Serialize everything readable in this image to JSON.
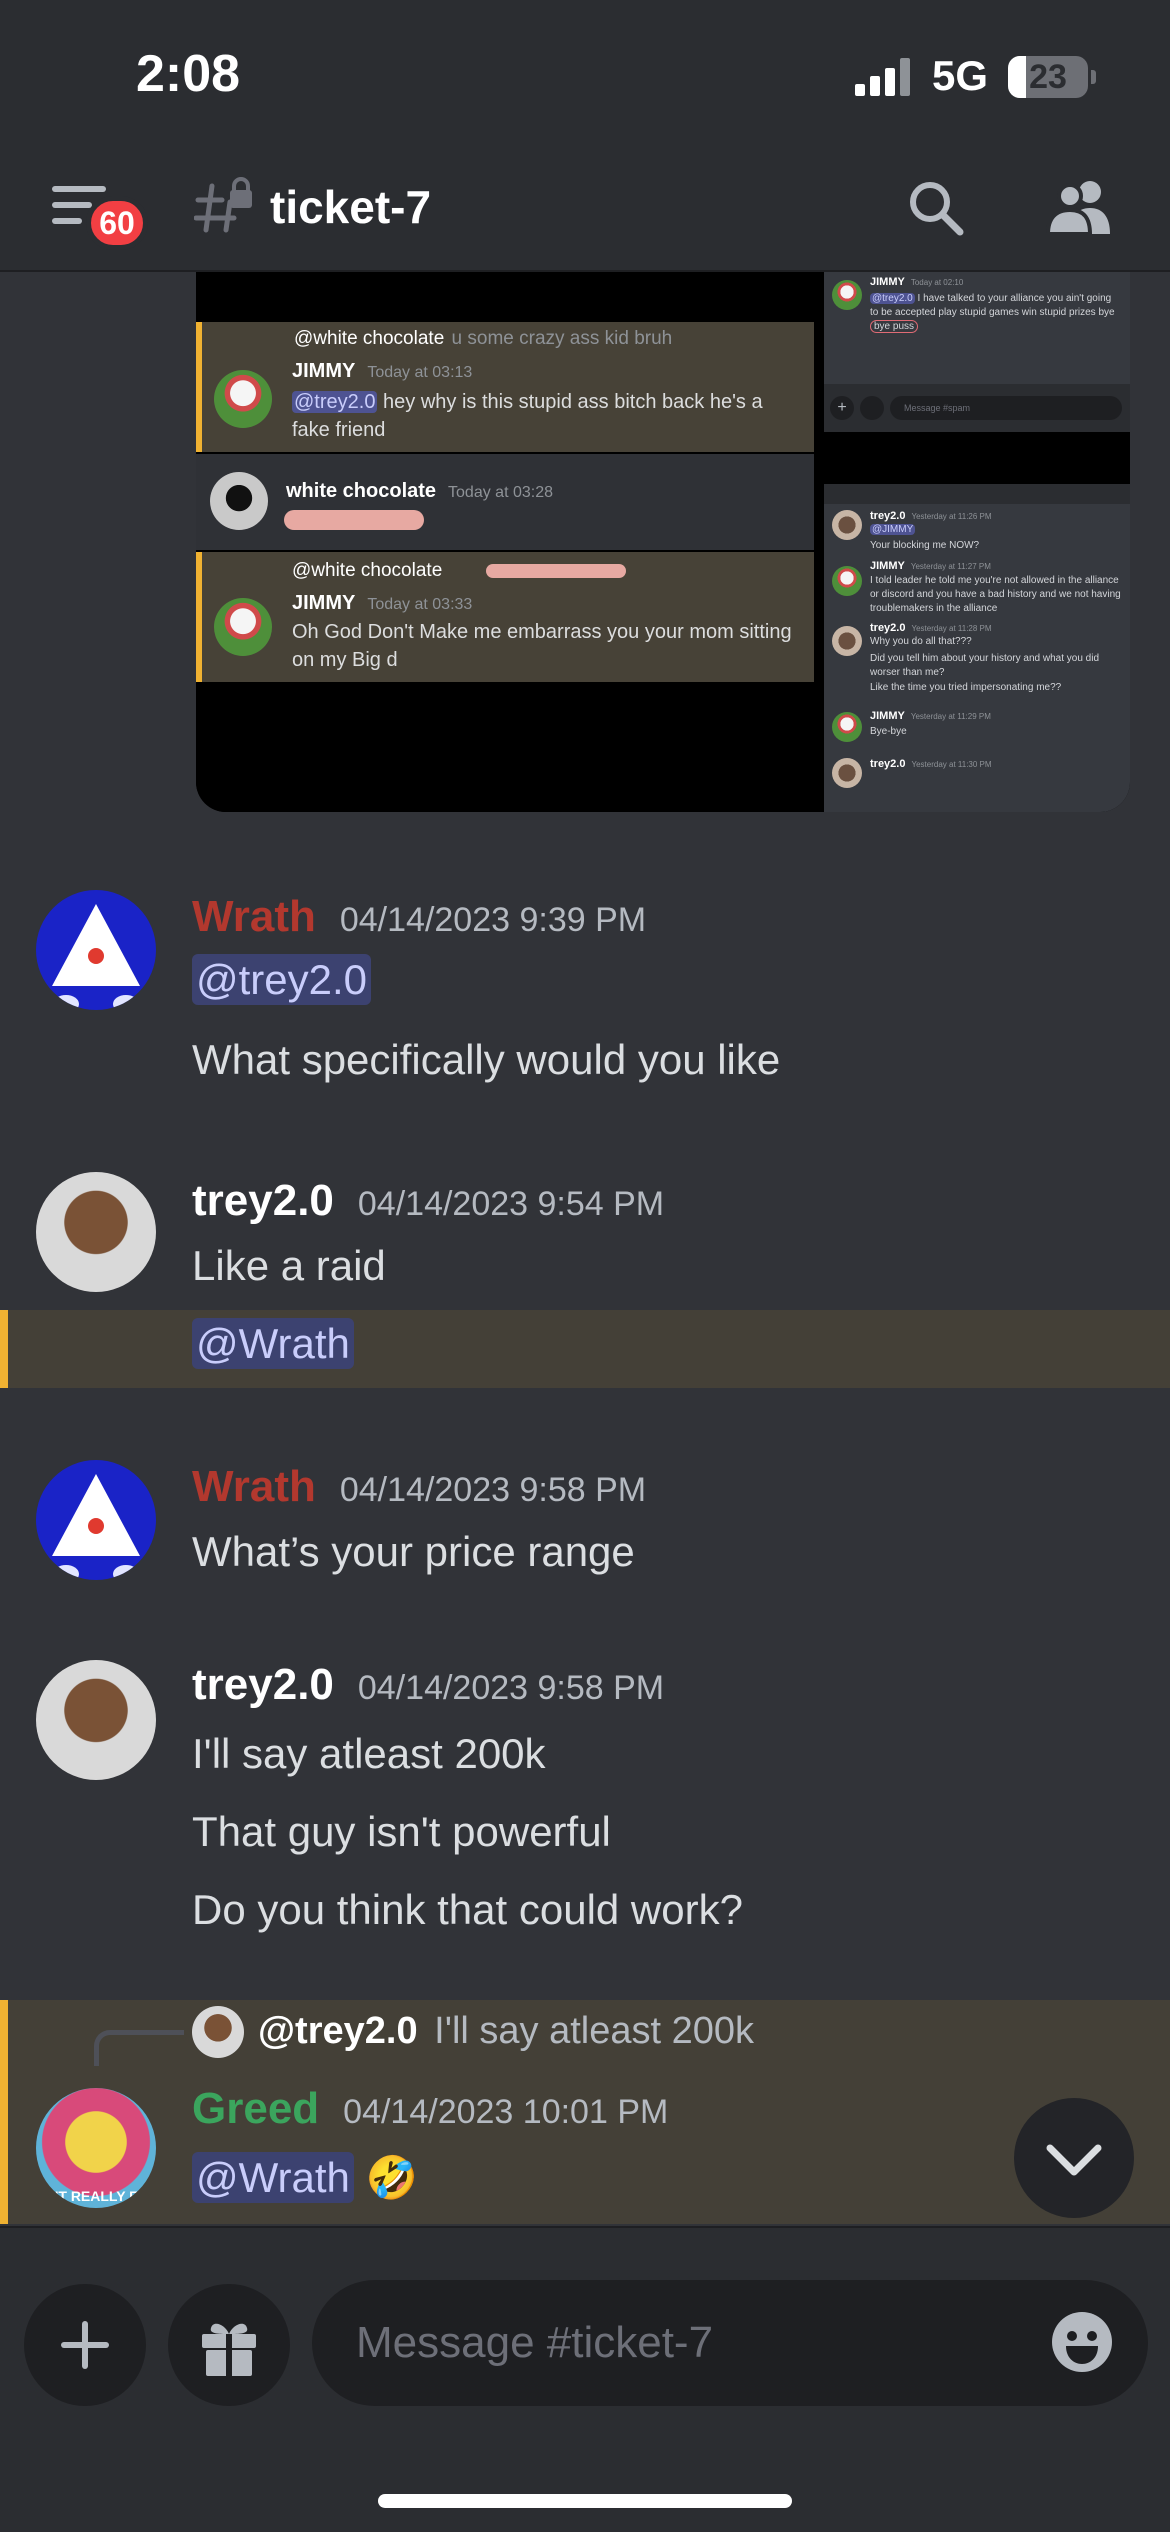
{
  "status_bar": {
    "time": "2:08",
    "network": "5G",
    "battery": "23"
  },
  "header": {
    "unread_badge": "60",
    "channel_name": "ticket-7"
  },
  "attachment": {
    "left_panel": {
      "reply1": {
        "mention": "@white chocolate",
        "text": "u some crazy ass kid bruh"
      },
      "msg1": {
        "author": "JIMMY",
        "time": "Today at 03:13",
        "mention": "@trey2.0",
        "text": "hey why is this stupid ass bitch back he's a fake friend"
      },
      "msg2": {
        "author": "white chocolate",
        "time": "Today at 03:28"
      },
      "reply2": {
        "mention": "@white chocolate"
      },
      "msg3": {
        "author": "JIMMY",
        "time": "Today at 03:33",
        "text": "Oh God Don't Make me embarrass you your mom sitting on my Big d"
      }
    },
    "right_panel": {
      "top_msg": {
        "author": "JIMMY",
        "time": "Today at 02:10",
        "mention": "@trey2.0",
        "text": "I have talked to your alliance you ain't going to be accepted play stupid games win stupid prizes bye",
        "circled": "bye puss"
      },
      "input_placeholder": "Message #spam",
      "messages": [
        {
          "author": "trey2.0",
          "time": "Yesterday at 11:26 PM",
          "mention": "@JIMMY",
          "text": "Your blocking me NOW?"
        },
        {
          "author": "JIMMY",
          "time": "Yesterday at 11:27 PM",
          "text": "I told leader he told me you're not allowed in the alliance or discord and you have a bad history and we not having troublemakers in the alliance"
        },
        {
          "author": "trey2.0",
          "time": "Yesterday at 11:28 PM",
          "text": "Why you do all that???",
          "text2": "Did you tell him about your history and what you did worser than me?",
          "text3": "Like the time you tried impersonating me??"
        },
        {
          "author": "JIMMY",
          "time": "Yesterday at 11:29 PM",
          "text": "Bye-bye"
        },
        {
          "author": "trey2.0",
          "time": "Yesterday at 11:30 PM"
        }
      ]
    }
  },
  "messages": [
    {
      "author": "Wrath",
      "author_color": "#b3382e",
      "timestamp": "04/14/2023 9:39 PM",
      "mention": "@trey2.0",
      "text": "What specifically would you like"
    },
    {
      "author": "trey2.0",
      "author_color": "#ffffff",
      "timestamp": "04/14/2023 9:54 PM",
      "text": "Like a raid",
      "mention": "@Wrath"
    },
    {
      "author": "Wrath",
      "author_color": "#b3382e",
      "timestamp": "04/14/2023 9:58 PM",
      "text": "What’s your price range"
    },
    {
      "author": "trey2.0",
      "author_color": "#ffffff",
      "timestamp": "04/14/2023 9:58 PM",
      "lines": [
        "I'll say atleast 200k",
        "That guy isn't powerful",
        "Do you think that could work?"
      ]
    },
    {
      "author": "Greed",
      "author_color": "#3ba55d",
      "timestamp": "04/14/2023 10:01 PM",
      "reply_to": "@trey2.0",
      "reply_text": "I'll say atleast 200k",
      "mention": "@Wrath",
      "emoji": "🤣",
      "avatar_caption": "N'T REALLY FE"
    }
  ],
  "composer": {
    "placeholder": "Message #ticket-7"
  },
  "icons": [
    "menu-icon",
    "channel-lock-icon",
    "search-icon",
    "members-icon",
    "chevron-down-icon",
    "plus-icon",
    "gift-icon",
    "emoji-icon"
  ]
}
